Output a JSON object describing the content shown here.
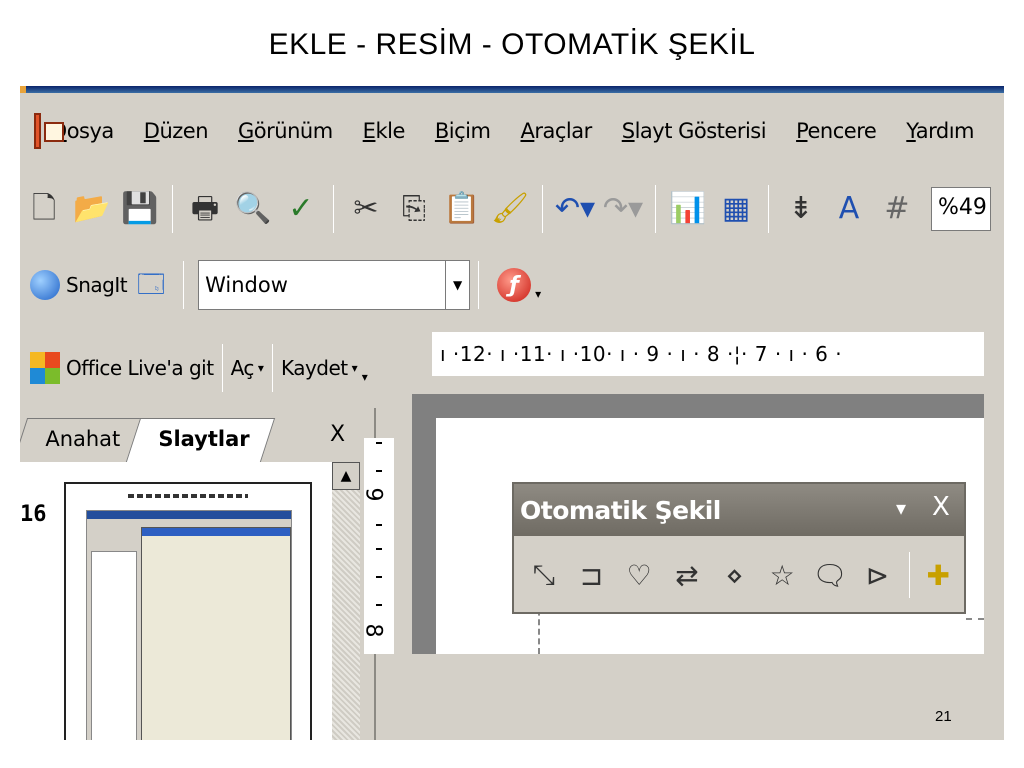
{
  "slide": {
    "title": "EKLE  - RESİM  - OTOMATİK ŞEKİL",
    "number": "21"
  },
  "menu": {
    "items": [
      "Dosya",
      "Düzen",
      "Görünüm",
      "Ekle",
      "Biçim",
      "Araçlar",
      "Slayt Gösterisi",
      "Pencere",
      "Yardım"
    ]
  },
  "toolbar": {
    "icons": [
      "new-document-icon",
      "open-folder-icon",
      "save-icon",
      "print-icon",
      "print-preview-icon",
      "spelling-icon",
      "cut-icon",
      "copy-icon",
      "paste-icon",
      "format-painter-icon",
      "undo-icon",
      "redo-icon",
      "insert-chart-icon",
      "insert-table-icon",
      "expand-icon",
      "text-color-icon",
      "grid-icon"
    ],
    "zoom": "%49"
  },
  "snagit_bar": {
    "label": "SnagIt",
    "combo_value": "Window"
  },
  "live_bar": {
    "office_live": "Office Live'a git",
    "open": "Aç",
    "save": "Kaydet"
  },
  "left_pane": {
    "tabs": [
      "Anahat",
      "Slaytlar"
    ],
    "close": "X",
    "slide_number": "16"
  },
  "ruler": {
    "horizontal": "ı ·12· ı ·11· ı ·10· ı · 9 · ı · 8 ·¦· 7 · ı · 6 ·",
    "vertical": [
      "9",
      "8"
    ]
  },
  "autoshape_toolbar": {
    "title": "Otomatik Şekil",
    "close": "X",
    "icons": [
      "lines-icon",
      "connectors-icon",
      "basic-shapes-icon",
      "block-arrows-icon",
      "flowchart-icon",
      "stars-banners-icon",
      "callouts-icon",
      "action-buttons-icon",
      "more-autoshapes-icon"
    ]
  }
}
